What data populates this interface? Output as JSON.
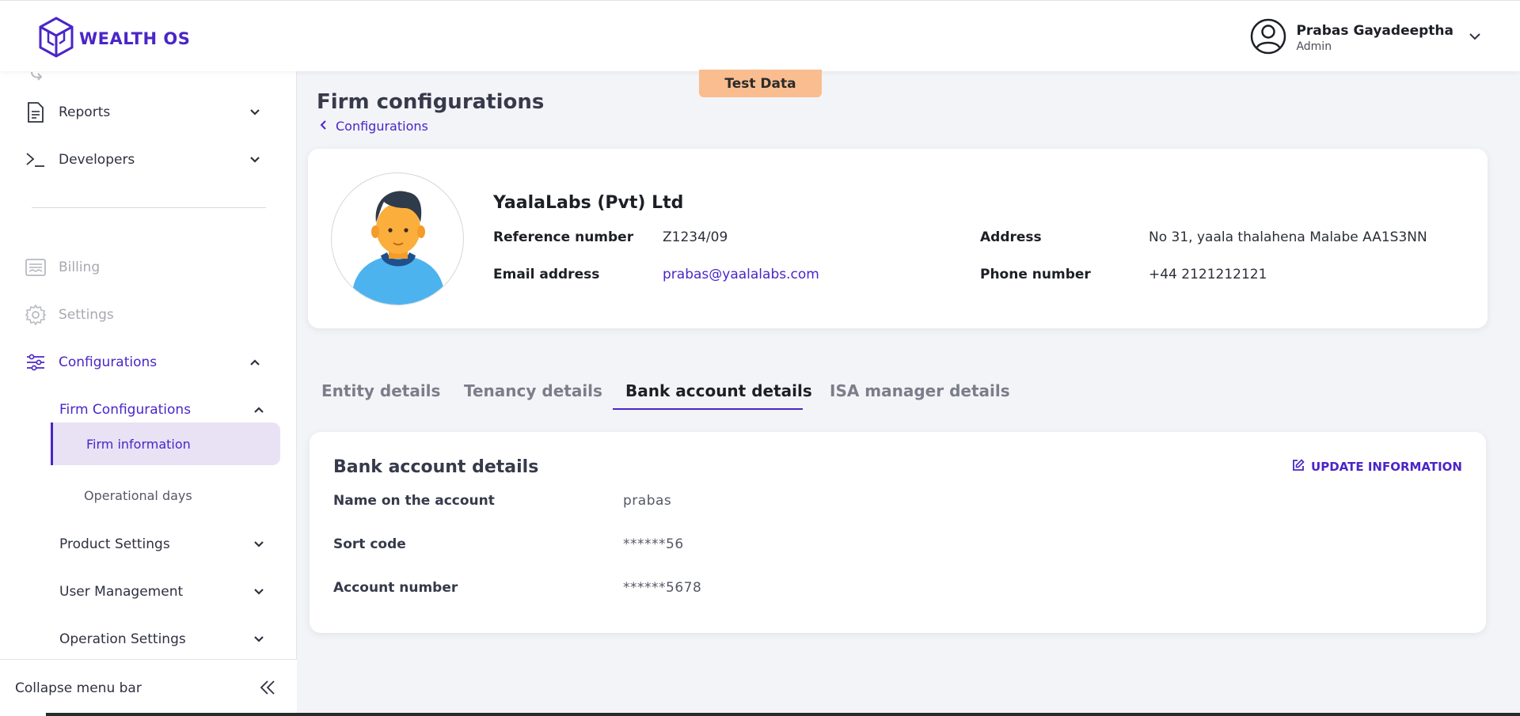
{
  "brand": {
    "name": "WEALTH OS",
    "color": "#4a25c8"
  },
  "user": {
    "name": "Prabas Gayadeeptha",
    "role": "Admin"
  },
  "badge": {
    "label": "Test Data",
    "color": "#f9bd8f"
  },
  "sidebar": {
    "items": [
      {
        "label": "Reports",
        "icon": "document-icon"
      },
      {
        "label": "Developers",
        "icon": "terminal-icon"
      },
      {
        "label": "Billing",
        "icon": "billing-icon"
      },
      {
        "label": "Settings",
        "icon": "gear-icon"
      },
      {
        "label": "Configurations",
        "icon": "sliders-icon"
      }
    ],
    "sub_items": [
      {
        "label": "Firm Configurations"
      },
      {
        "label": "Firm information"
      },
      {
        "label": "Operational days"
      },
      {
        "label": "Product Settings"
      },
      {
        "label": "User Management"
      },
      {
        "label": "Operation Settings"
      }
    ],
    "collapse_label": "Collapse menu bar"
  },
  "page": {
    "title": "Firm configurations",
    "breadcrumb": "Configurations"
  },
  "firm": {
    "name": "YaalaLabs (Pvt) Ltd",
    "reference_label": "Reference number",
    "reference_value": "Z1234/09",
    "email_label": "Email address",
    "email_value": "prabas@yaalalabs.com",
    "address_label": "Address",
    "address_value": "No 31, yaala thalahena Malabe AA1S3NN",
    "phone_label": "Phone number",
    "phone_value": "+44 2121212121"
  },
  "tabs": [
    {
      "label": "Entity details"
    },
    {
      "label": "Tenancy details"
    },
    {
      "label": "Bank account details",
      "active": true
    },
    {
      "label": "ISA manager details"
    }
  ],
  "bank": {
    "title": "Bank account details",
    "update_label": "UPDATE INFORMATION",
    "rows": [
      {
        "label": "Name on the account",
        "value": "prabas"
      },
      {
        "label": "Sort code",
        "value": "******56"
      },
      {
        "label": "Account number",
        "value": "******5678"
      }
    ]
  }
}
